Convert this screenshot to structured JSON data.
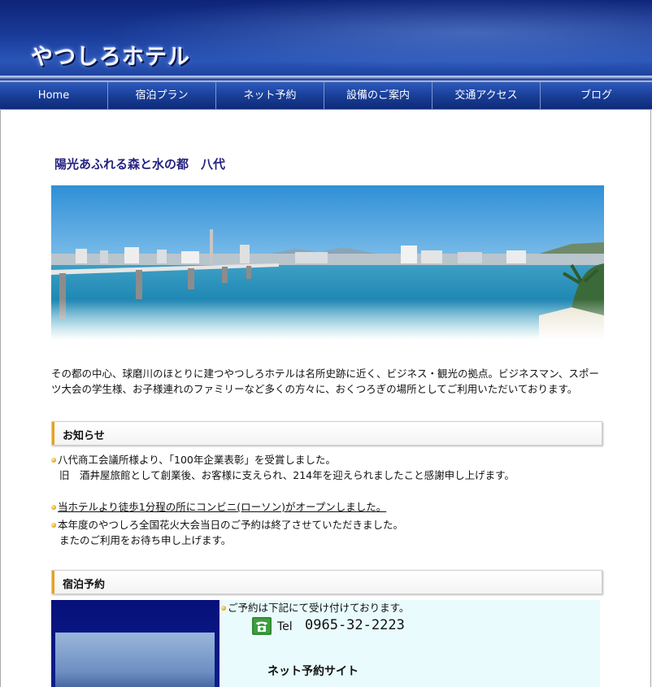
{
  "header": {
    "logo_text": "やつしろホテル"
  },
  "nav": {
    "items": [
      {
        "label": "Home"
      },
      {
        "label": "宿泊プラン"
      },
      {
        "label": "ネット予約"
      },
      {
        "label": "設備のご案内"
      },
      {
        "label": "交通アクセス"
      },
      {
        "label": "ブログ"
      }
    ]
  },
  "main": {
    "catch_copy": "陽光あふれる森と水の都　八代",
    "intro": "その都の中心、球磨川のほとりに建つやつしろホテルは名所史跡に近く、ビジネス・観光の拠点。ビジネスマン、スポーツ大会の学生様、お子様連れのファミリーなど多くの方々に、おくつろぎの場所としてご利用いただいております。"
  },
  "news": {
    "title": "お知らせ",
    "item1_line1": "八代商工会議所様より、「100年企業表彰」を受賞しました。",
    "item1_line2": "旧　酒井屋旅館として創業後、お客様に支えられ、214年を迎えられましたこと感謝申し上げます。",
    "item2_link": "当ホテルより徒歩1分程の所にコンビニ(ローソン)がオープンしました。",
    "item3_line1": "本年度のやつしろ全国花火大会当日のご予約は終了させていただきました。",
    "item3_line2": "またのご利用をお待ち申し上げます。"
  },
  "reservation": {
    "title": "宿泊予約",
    "note": "ご予約は下記にて受け付けております。",
    "tel_label": "Tel",
    "tel_number": "0965-32-2223",
    "net_title": "ネット予約サイト"
  },
  "colors": {
    "header_blue": "#1a3c9a",
    "nav_blue": "#1a3f98",
    "catch_color": "#25237f",
    "accent_orange": "#e6a21c",
    "reservation_bg": "#e9fbfc"
  }
}
